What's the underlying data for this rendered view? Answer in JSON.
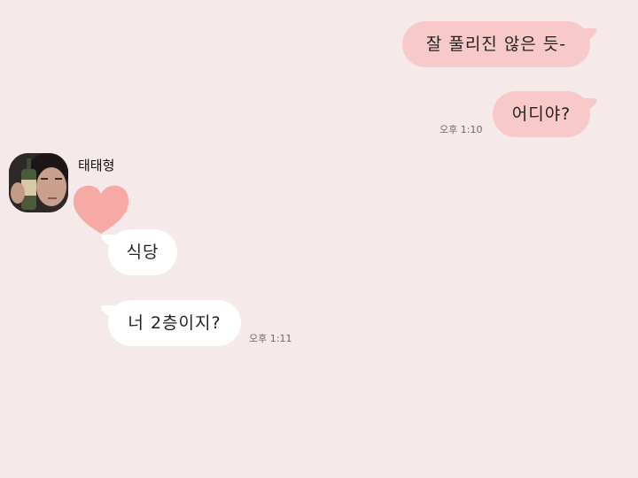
{
  "chat": {
    "sender_name": "태태형",
    "messages": [
      {
        "from": "me",
        "text": "잘 풀리진 않은 듯-"
      },
      {
        "from": "me",
        "text": "어디야?",
        "time": "오후 1:10"
      },
      {
        "from": "other",
        "type": "emoji",
        "icon": "heart-icon"
      },
      {
        "from": "other",
        "text": "식당"
      },
      {
        "from": "other",
        "text": "너 2층이지?",
        "time": "오후 1:11"
      }
    ]
  },
  "colors": {
    "background": "#f5e9e9",
    "my_bubble": "#f7c9c9",
    "other_bubble": "#ffffff",
    "heart": "#f7a9a6"
  }
}
